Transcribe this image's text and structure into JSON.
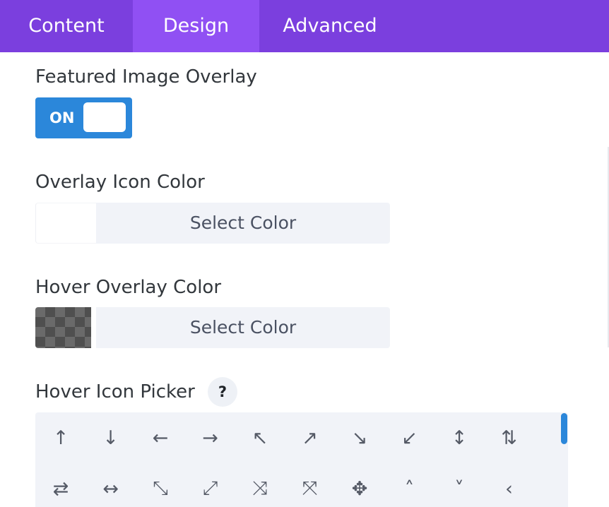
{
  "tabs": [
    {
      "label": "Content"
    },
    {
      "label": "Design"
    },
    {
      "label": "Advanced"
    }
  ],
  "active_tab": "Design",
  "featured_overlay": {
    "label": "Featured Image Overlay",
    "toggle_text": "ON",
    "toggle_color": "#2b87da"
  },
  "overlay_icon_color": {
    "label": "Overlay Icon Color",
    "button_label": "Select Color"
  },
  "hover_overlay_color": {
    "label": "Hover Overlay Color",
    "button_label": "Select Color"
  },
  "hover_icon_picker": {
    "label": "Hover Icon Picker",
    "help": "?",
    "row1": [
      {
        "glyph": "↑",
        "name": "arrow-up-icon"
      },
      {
        "glyph": "↓",
        "name": "arrow-down-icon"
      },
      {
        "glyph": "←",
        "name": "arrow-left-icon"
      },
      {
        "glyph": "→",
        "name": "arrow-right-icon"
      },
      {
        "glyph": "↖",
        "name": "arrow-up-left-icon"
      },
      {
        "glyph": "↗",
        "name": "arrow-up-right-icon"
      },
      {
        "glyph": "↘",
        "name": "arrow-down-right-icon"
      },
      {
        "glyph": "↙",
        "name": "arrow-down-left-icon"
      },
      {
        "glyph": "↕",
        "name": "arrow-up-down-icon"
      },
      {
        "glyph": "⇅",
        "name": "arrows-up-down-icon"
      }
    ],
    "row2": [
      {
        "glyph": "⇄",
        "name": "arrows-left-right-icon"
      },
      {
        "glyph": "↔",
        "name": "arrow-left-right-icon"
      },
      {
        "glyph": "⤡",
        "name": "arrow-diagonal-icon"
      },
      {
        "glyph": "⤢",
        "name": "expand-diagonal-icon"
      },
      {
        "glyph": "⤨",
        "name": "shrink-icon"
      },
      {
        "glyph": "⤧",
        "name": "expand-icon"
      },
      {
        "glyph": "✥",
        "name": "move-icon"
      },
      {
        "glyph": "˄",
        "name": "chevron-up-icon"
      },
      {
        "glyph": "˅",
        "name": "chevron-down-icon"
      },
      {
        "glyph": "‹",
        "name": "chevron-left-icon"
      }
    ]
  },
  "colors": {
    "tab_bar": "#7b3fde",
    "tab_active": "#9050f3",
    "accent": "#2b87da"
  }
}
